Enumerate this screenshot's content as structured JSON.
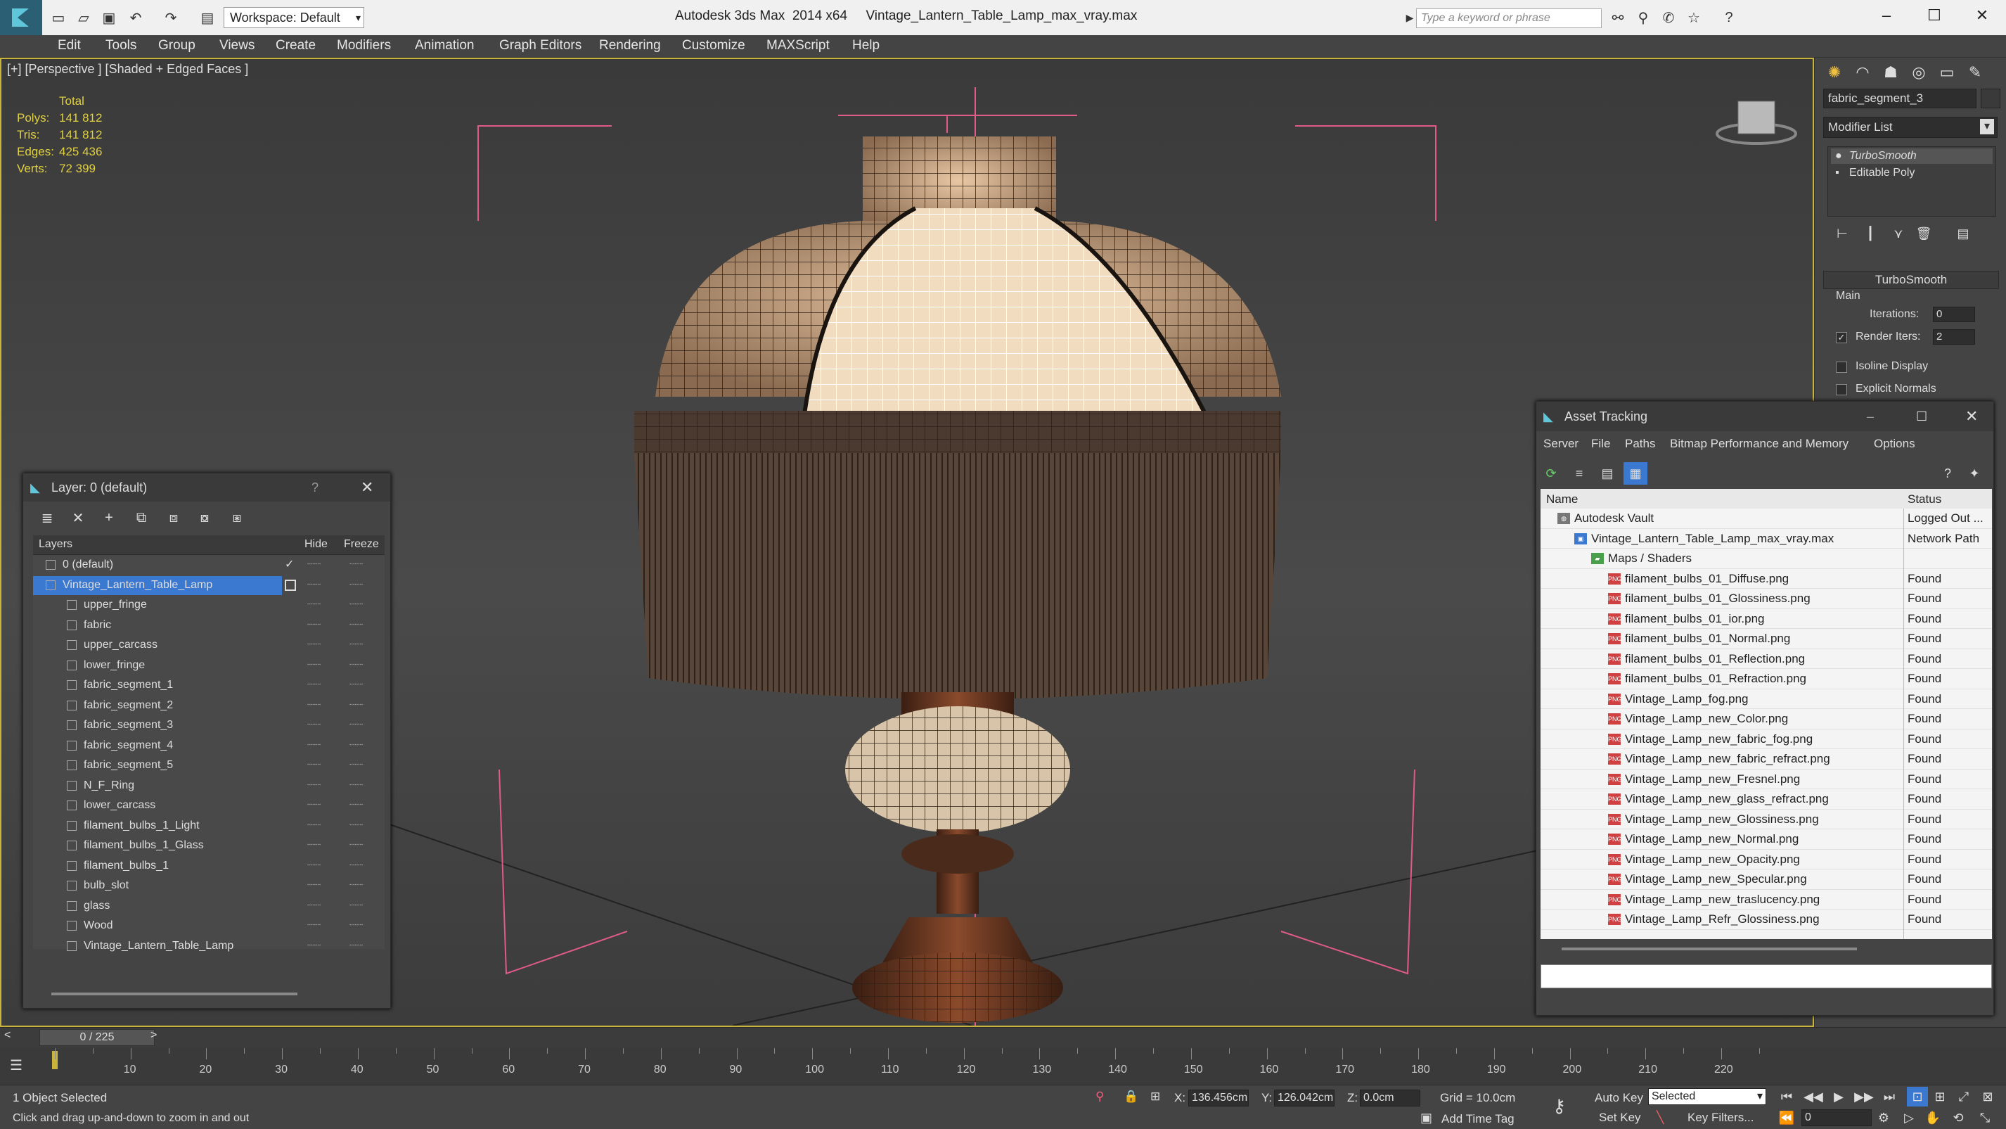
{
  "titlebar": {
    "app_title": "Autodesk 3ds Max  2014 x64",
    "file_name": "Vintage_Lantern_Table_Lamp_max_vray.max",
    "workspace": "Workspace: Default",
    "search_placeholder": "Type a keyword or phrase"
  },
  "menus": [
    "Edit",
    "Tools",
    "Group",
    "Views",
    "Create",
    "Modifiers",
    "Animation",
    "Graph Editors",
    "Rendering",
    "Customize",
    "MAXScript",
    "Help"
  ],
  "viewport": {
    "label": "[+] [Perspective ] [Shaded + Edged Faces ]",
    "stats": {
      "header": "Total",
      "polys_label": "Polys:",
      "polys": "141 812",
      "tris_label": "Tris:",
      "tris": "141 812",
      "edges_label": "Edges:",
      "edges": "425 436",
      "verts_label": "Verts:",
      "verts": "72 399"
    }
  },
  "command_panel": {
    "object_name": "fabric_segment_3",
    "modifier_list": "Modifier List",
    "stack": [
      "TurboSmooth",
      "Editable Poly"
    ],
    "rollout_title": "TurboSmooth",
    "group_main": "Main",
    "iterations_label": "Iterations:",
    "iterations": "0",
    "render_iters_label": "Render Iters:",
    "render_iters": "2",
    "isoline_label": "Isoline Display",
    "explicit_normals_label": "Explicit Normals"
  },
  "layer_window": {
    "title": "Layer: 0 (default)",
    "col_layers": "Layers",
    "col_hide": "Hide",
    "col_freeze": "Freeze",
    "rows": [
      {
        "name": "0 (default)",
        "level": 0
      },
      {
        "name": "Vintage_Lantern_Table_Lamp",
        "level": 0,
        "selected": true
      },
      {
        "name": "upper_fringe",
        "level": 1
      },
      {
        "name": "fabric",
        "level": 1
      },
      {
        "name": "upper_carcass",
        "level": 1
      },
      {
        "name": "lower_fringe",
        "level": 1
      },
      {
        "name": "fabric_segment_1",
        "level": 1
      },
      {
        "name": "fabric_segment_2",
        "level": 1
      },
      {
        "name": "fabric_segment_3",
        "level": 1
      },
      {
        "name": "fabric_segment_4",
        "level": 1
      },
      {
        "name": "fabric_segment_5",
        "level": 1
      },
      {
        "name": "N_F_Ring",
        "level": 1
      },
      {
        "name": "lower_carcass",
        "level": 1
      },
      {
        "name": "filament_bulbs_1_Light",
        "level": 1
      },
      {
        "name": "filament_bulbs_1_Glass",
        "level": 1
      },
      {
        "name": "filament_bulbs_1",
        "level": 1
      },
      {
        "name": "bulb_slot",
        "level": 1
      },
      {
        "name": "glass",
        "level": 1
      },
      {
        "name": "Wood",
        "level": 1
      },
      {
        "name": "Vintage_Lantern_Table_Lamp",
        "level": 1
      }
    ]
  },
  "asset_window": {
    "title": "Asset Tracking",
    "menu": [
      "Server",
      "File",
      "Paths",
      "Bitmap Performance and Memory",
      "Options"
    ],
    "col_name": "Name",
    "col_status": "Status",
    "rows": [
      {
        "name": "Autodesk Vault",
        "status": "Logged Out ...",
        "level": 0,
        "kind": "vault"
      },
      {
        "name": "Vintage_Lantern_Table_Lamp_max_vray.max",
        "status": "Network Path",
        "level": 1,
        "kind": "max"
      },
      {
        "name": "Maps / Shaders",
        "status": "",
        "level": 2,
        "kind": "folder"
      },
      {
        "name": "filament_bulbs_01_Diffuse.png",
        "status": "Found",
        "level": 3,
        "kind": "png"
      },
      {
        "name": "filament_bulbs_01_Glossiness.png",
        "status": "Found",
        "level": 3,
        "kind": "png"
      },
      {
        "name": "filament_bulbs_01_ior.png",
        "status": "Found",
        "level": 3,
        "kind": "png"
      },
      {
        "name": "filament_bulbs_01_Normal.png",
        "status": "Found",
        "level": 3,
        "kind": "png"
      },
      {
        "name": "filament_bulbs_01_Reflection.png",
        "status": "Found",
        "level": 3,
        "kind": "png"
      },
      {
        "name": "filament_bulbs_01_Refraction.png",
        "status": "Found",
        "level": 3,
        "kind": "png"
      },
      {
        "name": "Vintage_Lamp_fog.png",
        "status": "Found",
        "level": 3,
        "kind": "png"
      },
      {
        "name": "Vintage_Lamp_new_Color.png",
        "status": "Found",
        "level": 3,
        "kind": "png"
      },
      {
        "name": "Vintage_Lamp_new_fabric_fog.png",
        "status": "Found",
        "level": 3,
        "kind": "png"
      },
      {
        "name": "Vintage_Lamp_new_fabric_refract.png",
        "status": "Found",
        "level": 3,
        "kind": "png"
      },
      {
        "name": "Vintage_Lamp_new_Fresnel.png",
        "status": "Found",
        "level": 3,
        "kind": "png"
      },
      {
        "name": "Vintage_Lamp_new_glass_refract.png",
        "status": "Found",
        "level": 3,
        "kind": "png"
      },
      {
        "name": "Vintage_Lamp_new_Glossiness.png",
        "status": "Found",
        "level": 3,
        "kind": "png"
      },
      {
        "name": "Vintage_Lamp_new_Normal.png",
        "status": "Found",
        "level": 3,
        "kind": "png"
      },
      {
        "name": "Vintage_Lamp_new_Opacity.png",
        "status": "Found",
        "level": 3,
        "kind": "png"
      },
      {
        "name": "Vintage_Lamp_new_Specular.png",
        "status": "Found",
        "level": 3,
        "kind": "png"
      },
      {
        "name": "Vintage_Lamp_new_traslucency.png",
        "status": "Found",
        "level": 3,
        "kind": "png"
      },
      {
        "name": "Vintage_Lamp_Refr_Glossiness.png",
        "status": "Found",
        "level": 3,
        "kind": "png"
      }
    ]
  },
  "timeline": {
    "frame": "0 / 225",
    "ticks": [
      "10",
      "20",
      "30",
      "40",
      "50",
      "60",
      "70",
      "80",
      "90",
      "100",
      "110",
      "120",
      "130",
      "140",
      "150",
      "160",
      "170",
      "180",
      "190",
      "200",
      "210",
      "220"
    ]
  },
  "status": {
    "selection": "1 Object Selected",
    "prompt": "Click and drag up-and-down to zoom in and out",
    "x_label": "X:",
    "x": "136.456cm",
    "y_label": "Y:",
    "y": "126.042cm",
    "z_label": "Z:",
    "z": "0.0cm",
    "grid": "Grid = 10.0cm",
    "auto_key": "Auto Key",
    "selected": "Selected",
    "set_key": "Set Key",
    "key_filters": "Key Filters...",
    "add_time_tag": "Add Time Tag",
    "frame_field": "0"
  },
  "colors": {
    "accent": "#3b78d0",
    "viewport_border": "#c8b43a",
    "stats": "#e0d040",
    "gizmo": "#e05a8a"
  }
}
